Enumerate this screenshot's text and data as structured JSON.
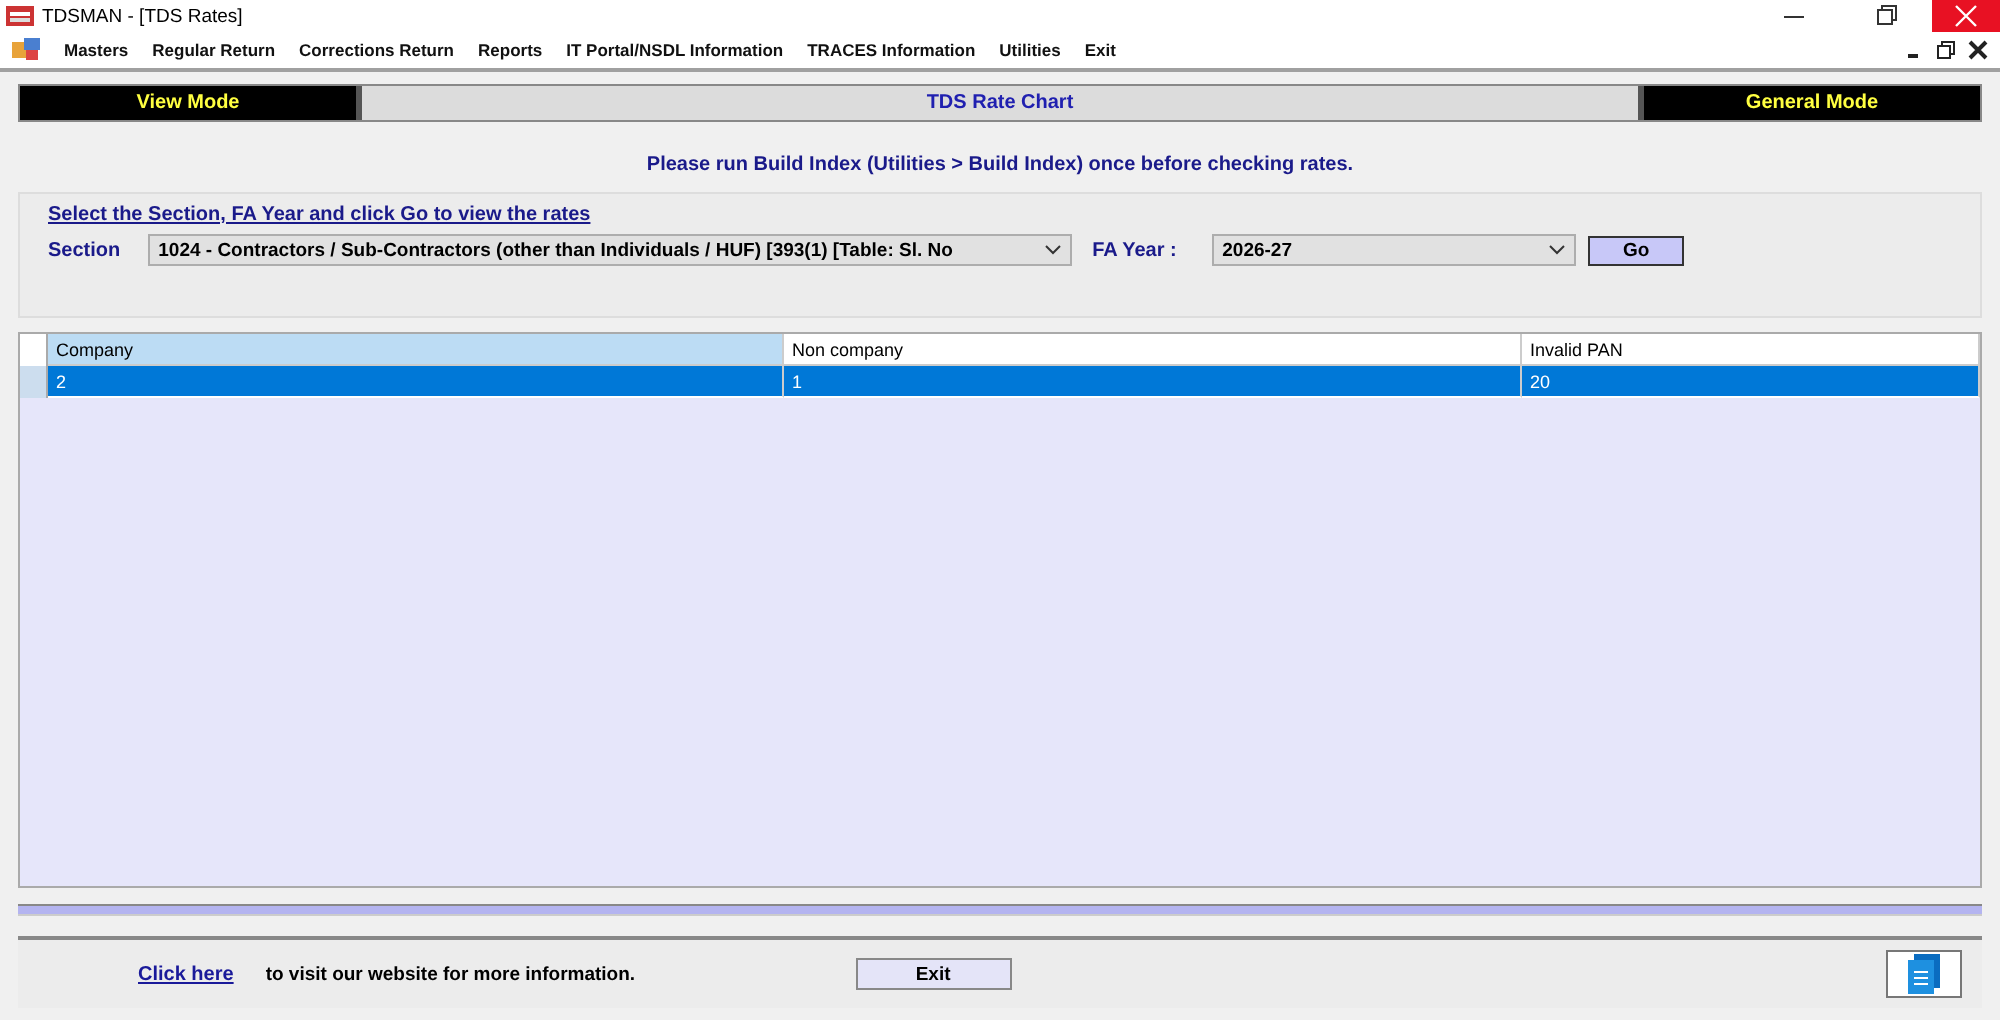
{
  "window": {
    "title": "TDSMAN - [TDS Rates]"
  },
  "menu": [
    "Masters",
    "Regular Return",
    "Corrections Return",
    "Reports",
    "IT Portal/NSDL Information",
    "TRACES Information",
    "Utilities",
    "Exit"
  ],
  "mode_bar": {
    "left": "View Mode",
    "center": "TDS Rate Chart",
    "right": "General Mode"
  },
  "notice": "Please run Build Index (Utilities > Build Index) once before checking rates.",
  "filter": {
    "instruction": "Select the Section, FA Year and click Go to view the rates",
    "section_label": "Section",
    "section_value": "1024 - Contractors / Sub-Contractors (other than Individuals / HUF) [393(1) [Table: Sl. No",
    "year_label": "FA Year :",
    "year_value": "2026-27",
    "go_button": "Go"
  },
  "table": {
    "columns": [
      {
        "label": "Company",
        "selected": true
      },
      {
        "label": "Non company",
        "selected": false
      },
      {
        "label": "Invalid PAN",
        "selected": false
      }
    ],
    "rows": [
      {
        "cells": [
          "2",
          "1",
          "20"
        ],
        "selected": true
      }
    ]
  },
  "footer": {
    "link": "Click here",
    "text": "to visit our website for more information.",
    "exit_button": "Exit"
  }
}
